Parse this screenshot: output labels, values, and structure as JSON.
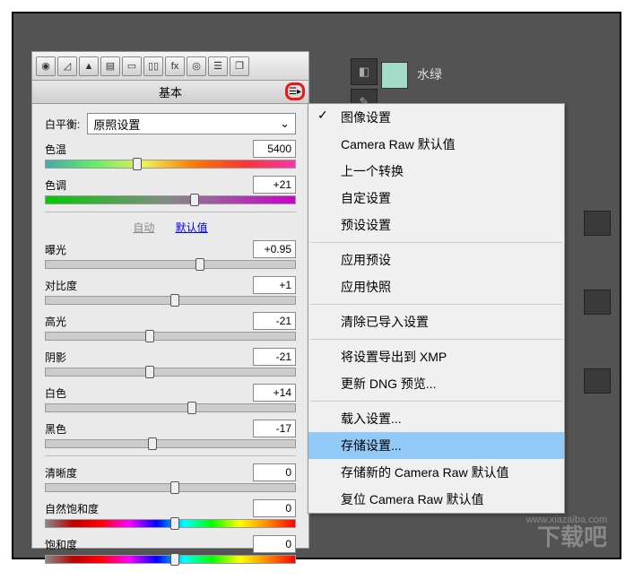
{
  "swatch": {
    "label": "水绿"
  },
  "panel": {
    "title": "基本",
    "wb_label": "白平衡:",
    "wb_value": "原照设置",
    "sliders": {
      "temp": {
        "label": "色温",
        "value": "5400",
        "pos": 35
      },
      "tint": {
        "label": "色调",
        "value": "+21",
        "pos": 58
      },
      "auto": "自动",
      "default": "默认值",
      "exposure": {
        "label": "曝光",
        "value": "+0.95",
        "pos": 60
      },
      "contrast": {
        "label": "对比度",
        "value": "+1",
        "pos": 50
      },
      "highlights": {
        "label": "高光",
        "value": "-21",
        "pos": 40
      },
      "shadows": {
        "label": "阴影",
        "value": "-21",
        "pos": 40
      },
      "whites": {
        "label": "白色",
        "value": "+14",
        "pos": 57
      },
      "blacks": {
        "label": "黑色",
        "value": "-17",
        "pos": 41
      },
      "clarity": {
        "label": "清晰度",
        "value": "0",
        "pos": 50
      },
      "vibrance": {
        "label": "自然饱和度",
        "value": "0",
        "pos": 50
      },
      "saturation": {
        "label": "饱和度",
        "value": "0",
        "pos": 50
      }
    }
  },
  "menu": {
    "items": [
      {
        "label": "图像设置",
        "checked": true
      },
      {
        "label": "Camera Raw 默认值"
      },
      {
        "label": "上一个转换"
      },
      {
        "label": "自定设置"
      },
      {
        "label": "预设设置"
      }
    ],
    "section2": [
      {
        "label": "应用预设"
      },
      {
        "label": "应用快照"
      }
    ],
    "section3": [
      {
        "label": "清除已导入设置"
      }
    ],
    "section4": [
      {
        "label": "将设置导出到 XMP"
      },
      {
        "label": "更新 DNG 预览..."
      }
    ],
    "section5": [
      {
        "label": "载入设置..."
      },
      {
        "label": "存储设置...",
        "selected": true
      },
      {
        "label": "存储新的 Camera Raw 默认值"
      },
      {
        "label": "复位 Camera Raw 默认值"
      }
    ]
  },
  "watermark": {
    "site": "www.xiazaiba.com",
    "logo": "下载吧"
  }
}
